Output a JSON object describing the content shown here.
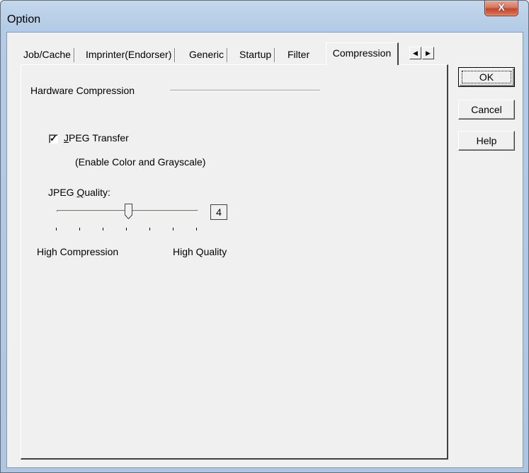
{
  "window": {
    "title": "Option",
    "close_label": "X"
  },
  "tabs": [
    {
      "label": "Job/Cache"
    },
    {
      "label": "Imprinter(Endorser)"
    },
    {
      "label": "Generic"
    },
    {
      "label": "Startup"
    },
    {
      "label": "Filter"
    }
  ],
  "active_tab": {
    "label": "Compression"
  },
  "tab_scroll": {
    "left_icon": "arrow-left-icon",
    "right_icon": "arrow-right-icon"
  },
  "compression": {
    "group_label": "Hardware Compression",
    "jpeg_transfer": {
      "label_prefix": "J",
      "label_rest": "PEG Transfer",
      "checked": true,
      "note": "(Enable Color and Grayscale)"
    },
    "jpeg_quality": {
      "label_prefix": "JPEG ",
      "label_accel": "Q",
      "label_rest": "uality:",
      "value": "4",
      "min_label": "High Compression",
      "max_label": "High Quality"
    }
  },
  "buttons": {
    "ok": "OK",
    "cancel": "Cancel",
    "help": "Help"
  }
}
